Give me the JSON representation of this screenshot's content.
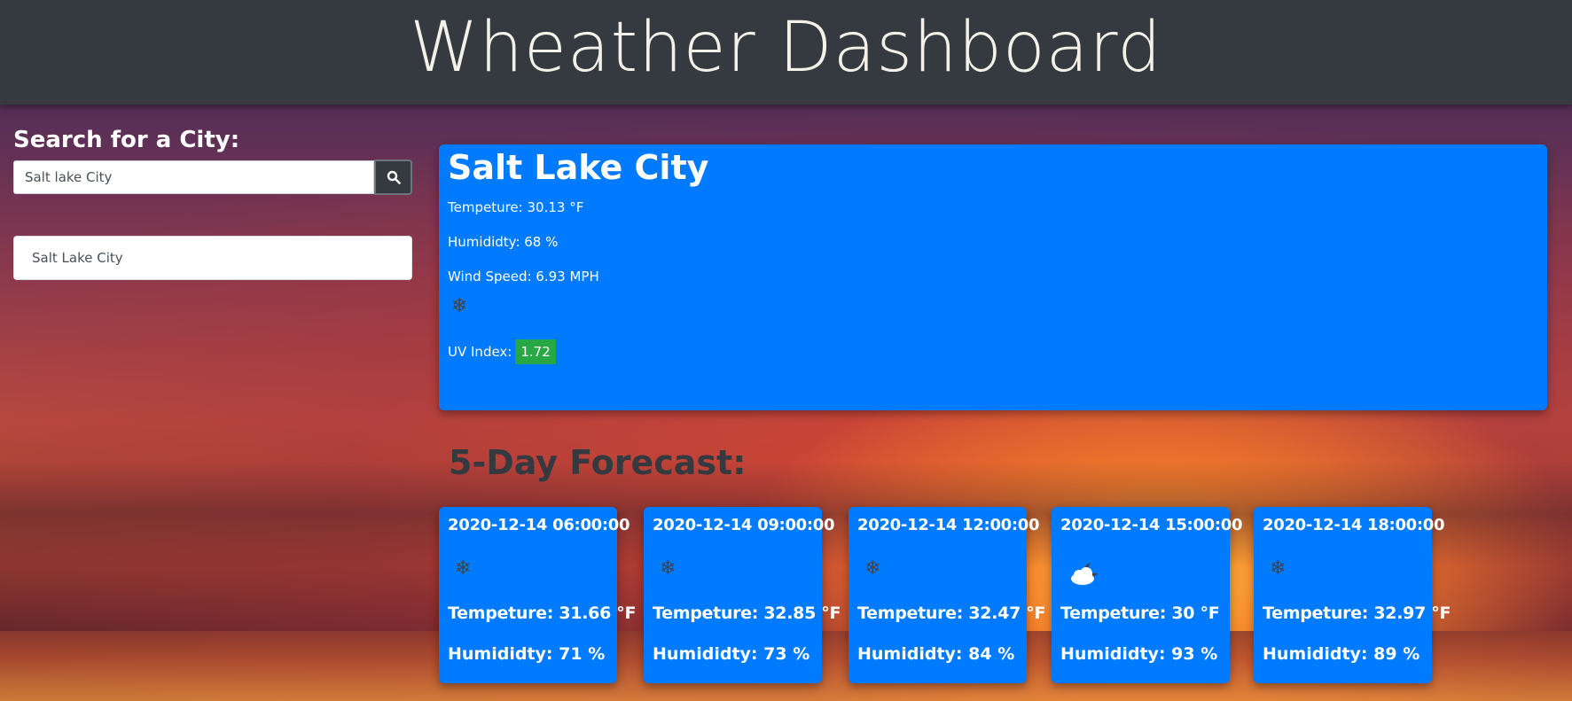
{
  "header": {
    "title": "Wheather Dashboard"
  },
  "search": {
    "label": "Search for a City:",
    "value": "Salt lake City",
    "button_icon": "search-icon"
  },
  "history": [
    {
      "label": "Salt Lake City"
    }
  ],
  "current": {
    "city": "Salt Lake City",
    "temperature": "Tempeture: 30.13 °F",
    "humidity": "Humididty: 68 %",
    "wind": "Wind Speed: 6.93 MPH",
    "icon": "snowflake-icon",
    "uv_label": "UV Index:",
    "uv_value": "1.72",
    "uv_color": "#28a745"
  },
  "forecast": {
    "title": "5-Day Forecast:",
    "days": [
      {
        "date": "2020-12-14 06:00:00",
        "icon": "snowflake-icon",
        "temp": "Tempeture: 31.66 °F",
        "humidity": "Humididty: 71 %"
      },
      {
        "date": "2020-12-14 09:00:00",
        "icon": "snowflake-icon",
        "temp": "Tempeture: 32.85 °F",
        "humidity": "Humididty: 73 %"
      },
      {
        "date": "2020-12-14 12:00:00",
        "icon": "snowflake-icon",
        "temp": "Tempeture: 32.47 °F",
        "humidity": "Humididty: 84 %"
      },
      {
        "date": "2020-12-14 15:00:00",
        "icon": "cloud-night-icon",
        "temp": "Tempeture: 30 °F",
        "humidity": "Humididty: 93 %"
      },
      {
        "date": "2020-12-14 18:00:00",
        "icon": "snowflake-icon",
        "temp": "Tempeture: 32.97 °F",
        "humidity": "Humididty: 89 %"
      }
    ]
  },
  "colors": {
    "header_bg": "#343a40",
    "card_bg": "#007bff",
    "uv_low": "#28a745"
  }
}
